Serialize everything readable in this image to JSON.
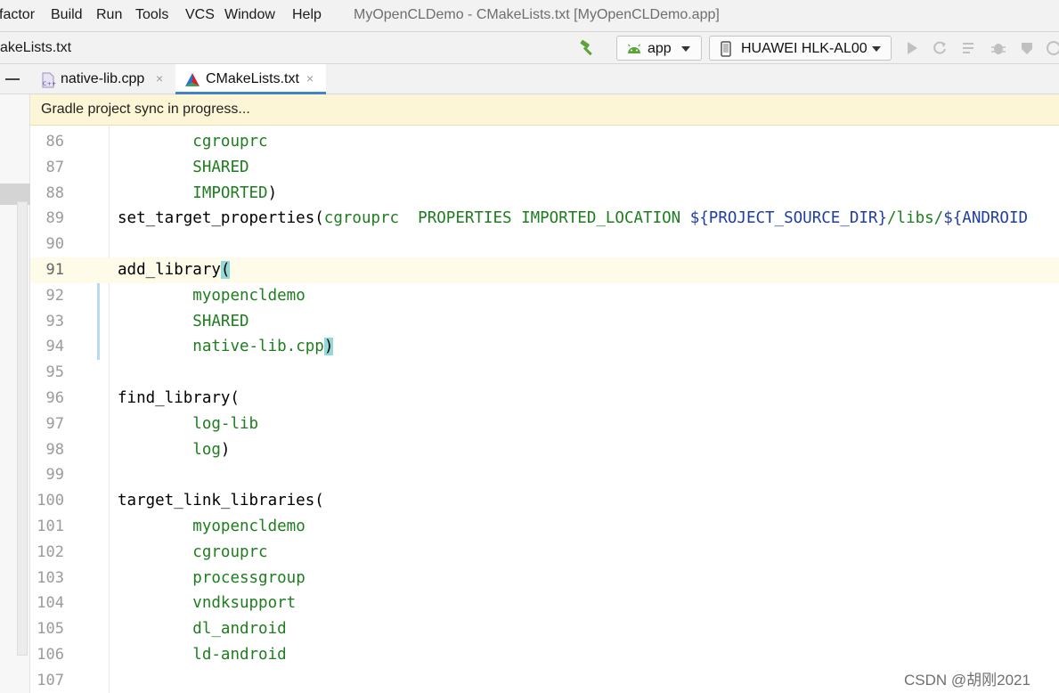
{
  "menu": {
    "refactor": "factor",
    "build": "Build",
    "run": "Run",
    "tools": "Tools",
    "vcs": "VCS",
    "window": "Window",
    "help": "Help"
  },
  "window_title": "MyOpenCLDemo - CMakeLists.txt [MyOpenCLDemo.app]",
  "navbar": {
    "breadcrumb_file": "akeLists.txt",
    "run_config": "app",
    "device": "HUAWEI HLK-AL00"
  },
  "tabs": [
    {
      "label": "native-lib.cpp",
      "icon": "cpp-file-icon",
      "active": false
    },
    {
      "label": "CMakeLists.txt",
      "icon": "cmake-icon",
      "active": true
    }
  ],
  "tab_close_glyph": "×",
  "banner": "Gradle project sync in progress...",
  "code_lines": [
    {
      "n": "86"
    },
    {
      "n": "87"
    },
    {
      "n": "88"
    },
    {
      "n": "89"
    },
    {
      "n": "90"
    },
    {
      "n": "91"
    },
    {
      "n": "92"
    },
    {
      "n": "93"
    },
    {
      "n": "94"
    },
    {
      "n": "95"
    },
    {
      "n": "96"
    },
    {
      "n": "97"
    },
    {
      "n": "98"
    },
    {
      "n": "99"
    },
    {
      "n": "100"
    },
    {
      "n": "101"
    },
    {
      "n": "102"
    },
    {
      "n": "103"
    },
    {
      "n": "104"
    },
    {
      "n": "105"
    },
    {
      "n": "106"
    },
    {
      "n": "107"
    }
  ],
  "code": {
    "l86": "cgrouprc",
    "l87": "SHARED",
    "l88_arg": "IMPORTED",
    "l88_paren": ")",
    "l89_fn": "set_target_properties(",
    "l89_arg1": "cgrouprc",
    "l89_arg2": "PROPERTIES IMPORTED_LOCATION",
    "l89_var1": "${PROJECT_SOURCE_DIR}",
    "l89_path": "/libs/",
    "l89_var2": "${ANDROID",
    "l91_fn": "add_library",
    "l91_paren": "(",
    "l92": "myopencldemo",
    "l93": "SHARED",
    "l94_arg": "native-lib.cpp",
    "l94_paren": ")",
    "l96": "find_library(",
    "l97": "log-lib",
    "l98_arg": "log",
    "l98_paren": ")",
    "l100": "target_link_libraries(",
    "l101": "myopencldemo",
    "l102": "cgrouprc",
    "l103": "processgroup",
    "l104": "vndksupport",
    "l105": "dl_android",
    "l106": "ld-android"
  },
  "current_line": "91",
  "watermark": "CSDN @胡刚2021",
  "colors": {
    "argument_green": "#1e7d1e",
    "variable_blue": "#1f3ea1",
    "paren_match": "#93d9d9",
    "banner_bg": "#fcf6d7",
    "tab_underline": "#4083c9"
  }
}
